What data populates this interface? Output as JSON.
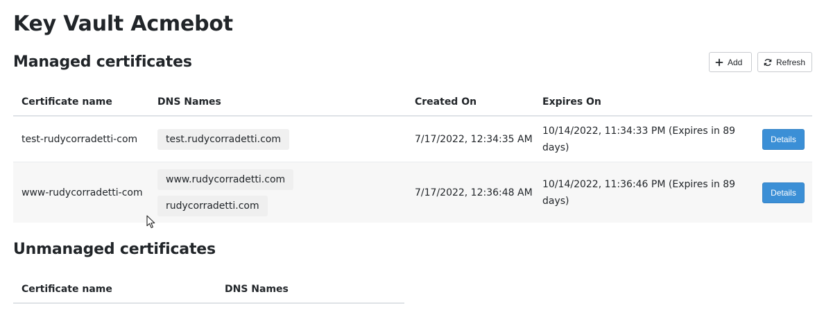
{
  "app": {
    "title": "Key Vault Acmebot"
  },
  "managed": {
    "title": "Managed certificates",
    "toolbar": {
      "add_label": "Add",
      "refresh_label": "Refresh"
    },
    "columns": [
      "Certificate name",
      "DNS Names",
      "Created On",
      "Expires On"
    ],
    "rows": [
      {
        "name": "test-rudycorradetti-com",
        "dns": [
          "test.rudycorradetti.com"
        ],
        "created": "7/17/2022, 12:34:35 AM",
        "expires": "10/14/2022, 11:34:33 PM (Expires in 89 days)",
        "action": "Details"
      },
      {
        "name": "www-rudycorradetti-com",
        "dns": [
          "www.rudycorradetti.com",
          "rudycorradetti.com"
        ],
        "created": "7/17/2022, 12:36:48 AM",
        "expires": "10/14/2022, 11:36:46 PM (Expires in 89 days)",
        "action": "Details"
      }
    ]
  },
  "unmanaged": {
    "title": "Unmanaged certificates",
    "columns": [
      "Certificate name",
      "DNS Names"
    ]
  },
  "colors": {
    "primary": "#3b8fd6",
    "badge": "#f0f0f0",
    "stripe": "#f7f7f7"
  },
  "icons": {
    "add": "plus-icon",
    "refresh": "refresh-icon",
    "cursor": "mouse-pointer-icon"
  }
}
